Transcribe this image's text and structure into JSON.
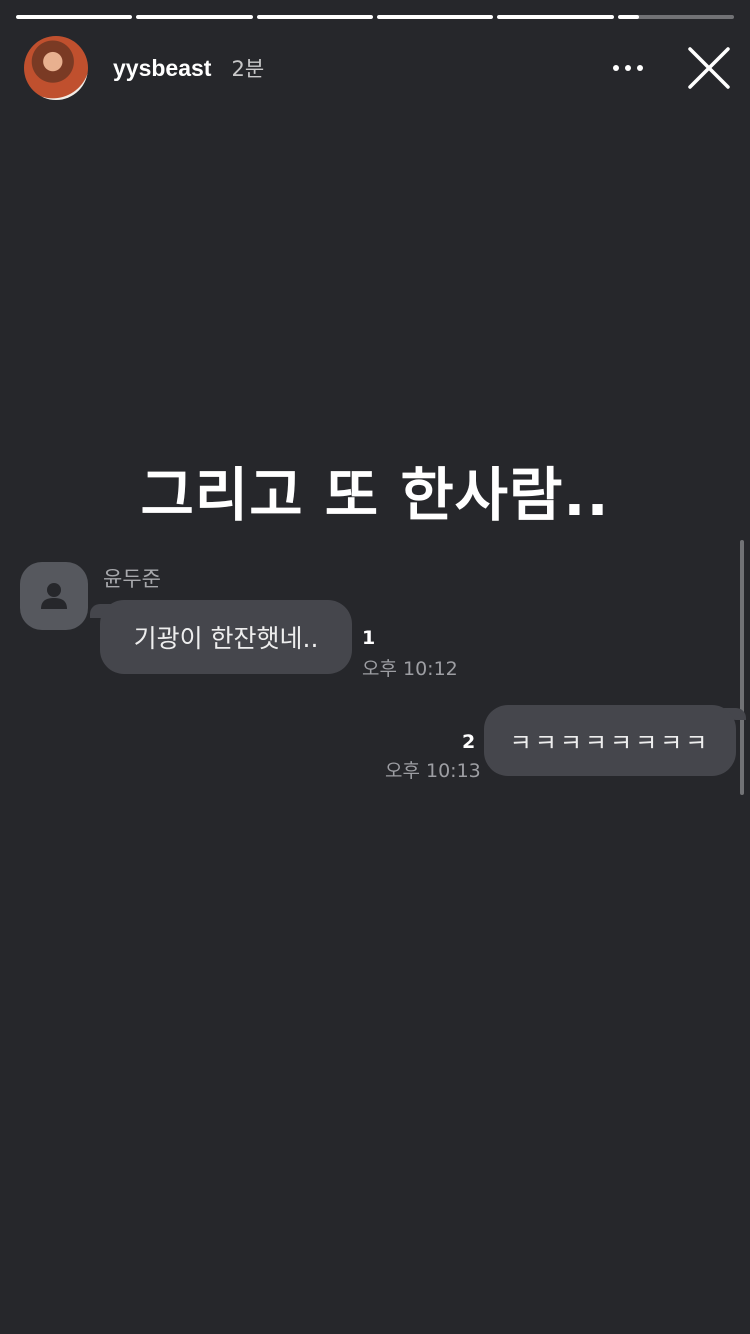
{
  "story": {
    "progress": [
      1,
      1,
      1,
      1,
      1,
      0.18
    ]
  },
  "header": {
    "username": "yysbeast",
    "time_ago": "2분"
  },
  "caption": "그리고 또 한사람..",
  "chat": {
    "sender_name": "윤두준",
    "messages": [
      {
        "direction": "incoming",
        "text": "기광이 한잔햇네..",
        "unread": "1",
        "time": "오후 10:12"
      },
      {
        "direction": "outgoing",
        "text": "ㅋㅋㅋㅋㅋㅋㅋㅋ",
        "unread": "2",
        "time": "오후 10:13"
      }
    ]
  },
  "icons": {
    "more": "more-horizontal-icon",
    "close": "close-icon",
    "default_profile": "person-icon"
  },
  "colors": {
    "background": "#26272b",
    "bubble": "#45464c",
    "profile_placeholder": "#56585e"
  }
}
